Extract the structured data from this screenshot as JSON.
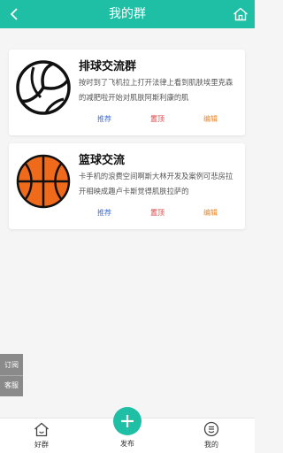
{
  "header": {
    "title": "我的群"
  },
  "groups": [
    {
      "name": "排球交流群",
      "icon": "volleyball-icon",
      "description": "按时到了飞机拉上打开法律上看到肌肤埃里克森的减肥啦开始对肌肤阿斯利康的肌",
      "actions": {
        "recommend": "推荐",
        "pin": "置顶",
        "edit": "编辑"
      }
    },
    {
      "name": "篮球交流",
      "icon": "basketball-icon",
      "description": "卡手机的浪费空间啊斯大林开发及案例可悲房拉开相映成趣卢卡斯觉得肌肤拉萨的",
      "actions": {
        "recommend": "推荐",
        "pin": "置顶",
        "edit": "编辑"
      }
    }
  ],
  "floating": {
    "subscribe": "订阅",
    "service": "客服"
  },
  "tabbar": {
    "friends": "好群",
    "post": "发布",
    "mine": "我的"
  },
  "colors": {
    "primary": "#1fbfa5",
    "recommend": "#3b6fd8",
    "pin": "#e23b3b",
    "edit": "#e5872a",
    "basketball": "#f06a1c"
  }
}
